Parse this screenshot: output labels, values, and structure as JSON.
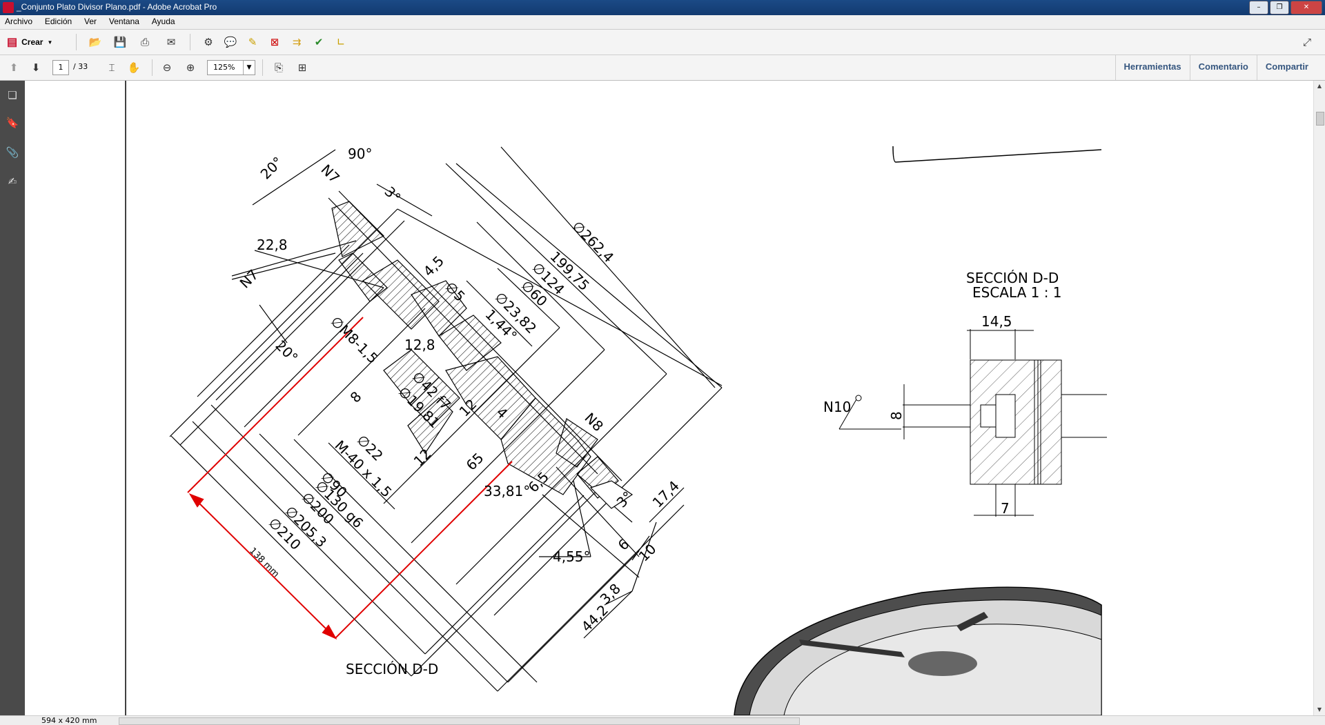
{
  "window": {
    "title": "_Conjunto Plato Divisor Plano.pdf - Adobe Acrobat Pro"
  },
  "menu": {
    "items": [
      "Archivo",
      "Edición",
      "Ver",
      "Ventana",
      "Ayuda"
    ]
  },
  "toolbar": {
    "create_label": "Crear"
  },
  "nav": {
    "current_page": "1",
    "total_pages": "/ 33",
    "zoom": "125%"
  },
  "panels": {
    "tools": "Herramientas",
    "comment": "Comentario",
    "share": "Compartir"
  },
  "status": {
    "page_size": "594 x 420 mm"
  },
  "drawing": {
    "dims": {
      "d1": "90°",
      "d2": "20°",
      "d3": "N7",
      "d4": "3°",
      "d5": "22,8",
      "d6": "N7",
      "d7": "∅262,4",
      "d8": "199,75",
      "d9": "∅124",
      "d10": "4,5",
      "d11": "∅60",
      "d12": "∅5",
      "d13": "∅23,82",
      "d14": "∅M8-1,5",
      "d15": "1,44°",
      "d16": "12,8",
      "d17": "20°",
      "d18": "∅42 f7",
      "d19": "8",
      "d20": "∅19,81",
      "d21": "12",
      "d22": "4",
      "d23": "N8",
      "d24": "∅22",
      "d25": "12",
      "d26": "65",
      "d27": "M-40 x 1,5",
      "d28": "∅90",
      "d29": "33,81°",
      "d30": "6,5",
      "d31": "3°",
      "d32": "17,4",
      "d33": "∅130 g6",
      "d34": "∅200",
      "d35": "∅205,3",
      "d36": "∅210",
      "d37": "6",
      "d38": "10",
      "d39": "4,55°",
      "d40": "3,8",
      "d41": "44,2",
      "d42": "SECCIÓN D-D"
    },
    "measure_label": "138 mm",
    "section_title": "SECCIÓN D-D",
    "section_scale": "ESCALA 1 : 1",
    "section_dims": {
      "s1": "14,5",
      "s2": "N10",
      "s3": "8",
      "s4": "7"
    }
  },
  "colors": {
    "measure": "#e00000",
    "titlebar": "#1b4a86",
    "link": "#35567f"
  }
}
